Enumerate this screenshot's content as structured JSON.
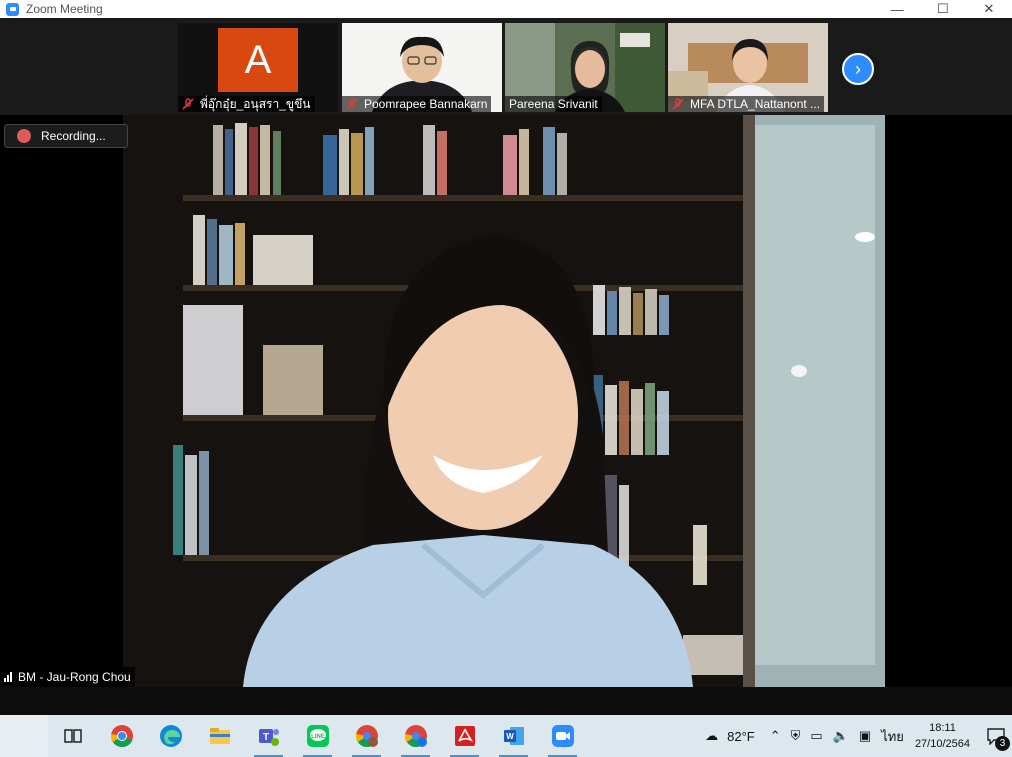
{
  "window": {
    "title": "Zoom Meeting"
  },
  "participants": [
    {
      "name": "พี่อุ๊กอุ๋ย_อนุสรา_ขูขึน",
      "muted": true,
      "avatar_letter": "A",
      "avatar_color": "#d8480f"
    },
    {
      "name": "Poomrapee Bannakarn",
      "muted": true
    },
    {
      "name": "Pareena Srivanit",
      "muted": false
    },
    {
      "name": "MFA DTLA_Nattanont ...",
      "muted": true
    }
  ],
  "recording": {
    "label": "Recording..."
  },
  "active_speaker": {
    "name": "BM - Jau-Rong Chou"
  },
  "colors": {
    "zoom_blue": "#2d8cff",
    "mute_red": "#e23b3b",
    "taskbar_bg": "#dce8ee"
  },
  "taskbar": {
    "apps": [
      {
        "icon": "task-view-icon"
      },
      {
        "icon": "chrome-icon"
      },
      {
        "icon": "edge-icon"
      },
      {
        "icon": "file-explorer-icon"
      },
      {
        "icon": "teams-icon"
      },
      {
        "icon": "line-icon"
      },
      {
        "icon": "chrome-profile-l-icon"
      },
      {
        "icon": "chrome-profile-a-icon"
      },
      {
        "icon": "acrobat-icon"
      },
      {
        "icon": "word-icon"
      },
      {
        "icon": "zoom-icon"
      }
    ],
    "weather": {
      "temp": "82°F"
    },
    "language": "ไทย",
    "clock": {
      "time": "18:11",
      "date": "27/10/2564"
    },
    "notifications": {
      "count": "3"
    }
  }
}
